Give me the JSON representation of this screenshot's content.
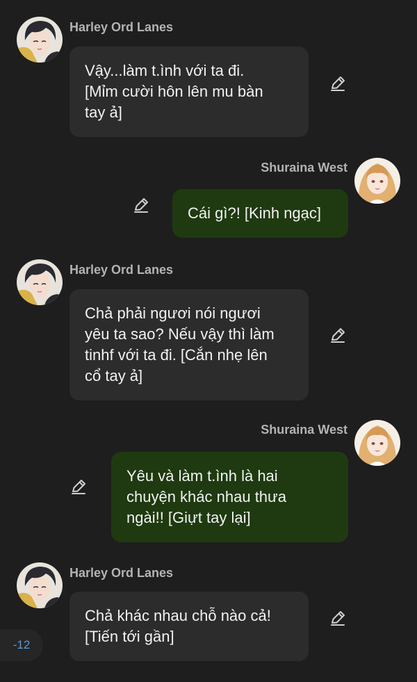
{
  "messages": [
    {
      "sender": "Harley Ord Lanes",
      "side": "left",
      "text": "Vậy...làm t.ình với ta đi.\n[Mỉm cười hôn lên mu bàn\ntay ả]",
      "edit_icon": "pencil-icon"
    },
    {
      "sender": "Shuraina West",
      "side": "right",
      "text": "Cái gì?! [Kinh ngạc]",
      "edit_icon": "pencil-icon"
    },
    {
      "sender": "Harley Ord Lanes",
      "side": "left",
      "text": "Chả phải ngươi nói ngươi\nyêu ta sao? Nếu vậy thì làm\ntinhf với ta đi. [Cắn nhẹ lên\ncổ tay ả]",
      "edit_icon": "pencil-icon"
    },
    {
      "sender": "Shuraina West",
      "side": "right",
      "text": "Yêu và làm t.ình là hai\nchuyện khác nhau thưa\nngài!! [Giựt tay lại]",
      "edit_icon": "pencil-icon"
    },
    {
      "sender": "Harley Ord Lanes",
      "side": "left",
      "text": "Chả khác nhau chỗ nào cả!\n[Tiến tới gần]",
      "edit_icon": "pencil-icon"
    }
  ],
  "unread_counter": "-12",
  "colors": {
    "background": "#1e1e1e",
    "left_bubble": "#2c2c2c",
    "right_bubble": "#1f3a10",
    "name_text": "#b3b3b3",
    "counter_text": "#5b9bd5"
  }
}
